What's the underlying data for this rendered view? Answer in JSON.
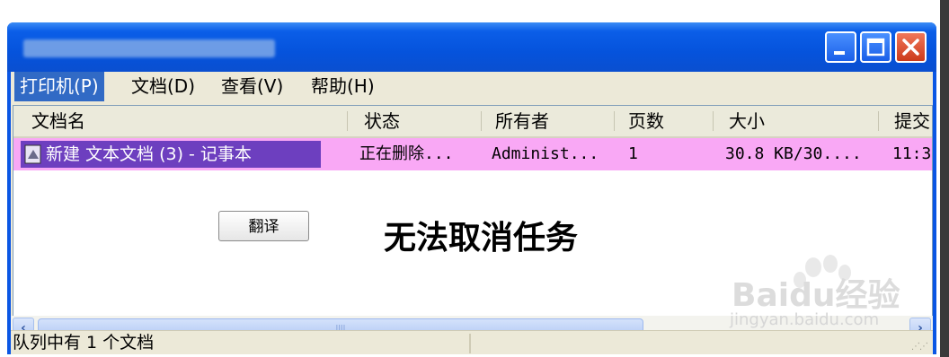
{
  "menu": [
    {
      "label": "打印机(P)",
      "active": true
    },
    {
      "label": "文档(D)"
    },
    {
      "label": "查看(V)"
    },
    {
      "label": "帮助(H)"
    }
  ],
  "columns": [
    "文档名",
    "状态",
    "所有者",
    "页数",
    "大小",
    "提交"
  ],
  "job": {
    "name": "新建 文本文档 (3) - 记事本",
    "status": "正在删除...",
    "owner": "Administ...",
    "pages": "1",
    "size": "30.8 KB/30....",
    "submitted": "11:3"
  },
  "overlay_text": "无法取消任务",
  "translate_button": "翻译",
  "status_bar": "队列中有 1 个文档",
  "watermark": {
    "brand": "Baidu经验",
    "url": "jingyan.baidu.com"
  },
  "colors": {
    "selection_row": "#f9a8f5",
    "selected_cell": "#6d3fbf",
    "titlebar": "#0553dc",
    "menu_active": "#316ac5"
  },
  "icons": [
    "minimize-icon",
    "maximize-icon",
    "close-icon",
    "document-icon",
    "scroll-left-icon",
    "scroll-right-icon",
    "resize-grip-icon"
  ]
}
